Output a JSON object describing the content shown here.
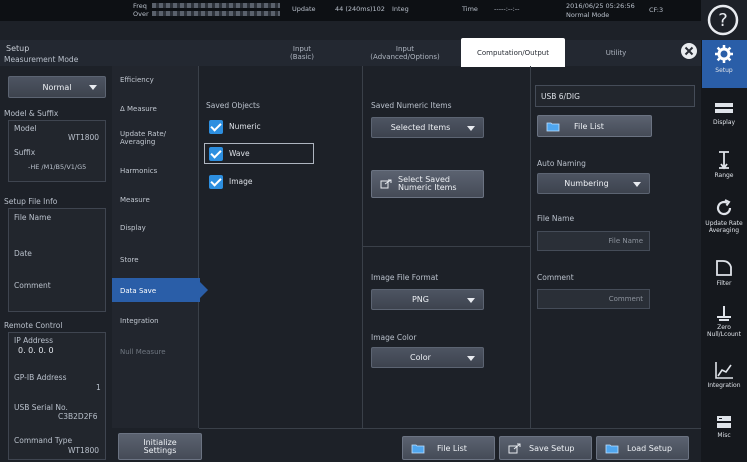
{
  "status": {
    "freq_label": "Freq",
    "over_label": "Over",
    "update_label": "Update",
    "update_value": "44 (240ms)102",
    "integ_label": "Integ",
    "time_label": "Time",
    "time_value": "-----:--:--",
    "date": "2016/06/25  05:26:56",
    "mode": "Normal Mode",
    "badge": "CF:3"
  },
  "header": {
    "title": "Setup"
  },
  "tabs": [
    {
      "label": "Input",
      "sub": "(Basic)"
    },
    {
      "label": "Input",
      "sub": "(Advanced/Options)"
    },
    {
      "label": "Computation/Output",
      "sub": ""
    },
    {
      "label": "Utility",
      "sub": ""
    }
  ],
  "left_panel": {
    "measurement_mode_label": "Measurement Mode",
    "measurement_mode_value": "Normal",
    "model_suffix_label": "Model & Suffix",
    "model_label": "Model",
    "model_value": "WT1800",
    "suffix_label": "Suffix",
    "suffix_value": "-HE /M1/B5/V1/G5",
    "setup_file_info_label": "Setup File Info",
    "file_name_label": "File Name",
    "date_label": "Date",
    "comment_label": "Comment",
    "remote_control_label": "Remote Control",
    "ip_address_label": "IP Address",
    "ip_address_value": "0.  0.  0.  0",
    "gpib_label": "GP-IB Address",
    "gpib_value": "1",
    "usb_serial_label": "USB Serial No.",
    "usb_serial_value": "C3B2D2F6",
    "command_type_label": "Command Type",
    "command_type_value": "WT1800"
  },
  "nav": {
    "items": [
      "Efficiency",
      "Δ Measure",
      "Update Rate/ Averaging",
      "Harmonics",
      "Measure",
      "Display",
      "Store",
      "Data Save",
      "Integration",
      "Null Measure"
    ],
    "initialize_label": "Initialize Settings"
  },
  "saved_objects": {
    "title": "Saved Objects",
    "items": [
      "Numeric",
      "Wave",
      "Image"
    ]
  },
  "numeric_items": {
    "title": "Saved Numeric Items",
    "value": "Selected Items",
    "select_button": "Select Saved Numeric Items"
  },
  "image": {
    "format_label": "Image File Format",
    "format_value": "PNG",
    "color_label": "Image Color",
    "color_value": "Color"
  },
  "file": {
    "path": "USB 6/DIG",
    "file_list_button": "File List",
    "auto_naming_label": "Auto Naming",
    "auto_naming_value": "Numbering",
    "file_name_label": "File Name",
    "file_name_placeholder": "File Name",
    "comment_label": "Comment",
    "comment_placeholder": "Comment"
  },
  "bottom": {
    "file_list": "File List",
    "save_setup": "Save Setup",
    "load_setup": "Load Setup"
  },
  "right_sidebar": [
    {
      "label": "Setup",
      "icon": "gear-icon"
    },
    {
      "label": "Display",
      "icon": "display-icon"
    },
    {
      "label": "Range",
      "icon": "range-icon"
    },
    {
      "label": "Update Rate Averaging",
      "icon": "update-icon"
    },
    {
      "label": "Filter",
      "icon": "filter-icon"
    },
    {
      "label": "Zero Null/Lcount",
      "icon": "zero-icon"
    },
    {
      "label": "Integration",
      "icon": "integration-icon"
    },
    {
      "label": "Misc",
      "icon": "misc-icon"
    }
  ],
  "colors": {
    "accent": "#2d8fe0",
    "selected_nav": "#2a5ea8",
    "background": "#1d2128"
  }
}
